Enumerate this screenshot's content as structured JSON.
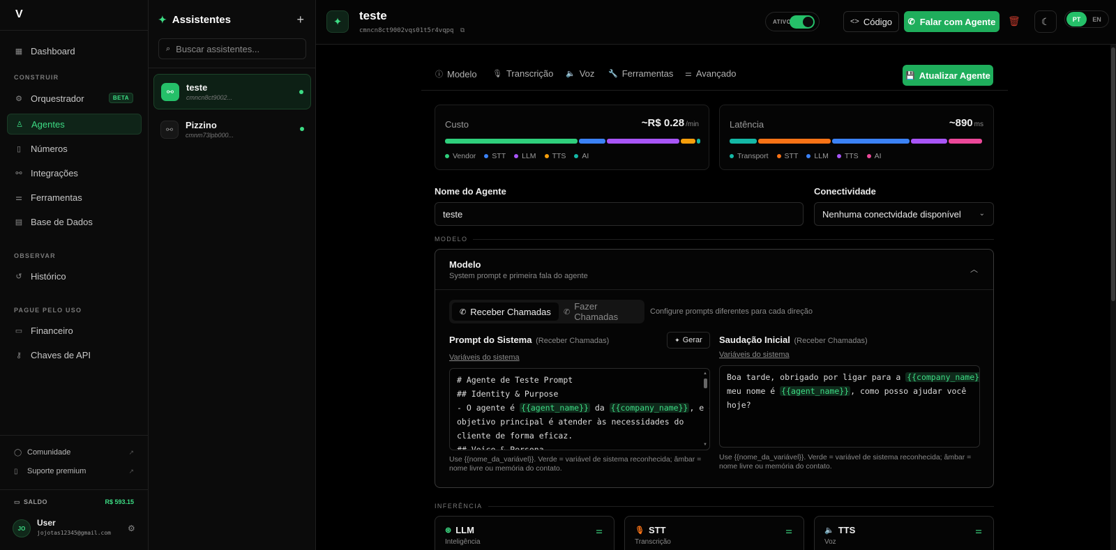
{
  "app": {
    "logo": "V"
  },
  "sidebar": {
    "dashboard": "Dashboard",
    "sections": {
      "construir": "CONSTRUIR",
      "observar": "OBSERVAR",
      "pague": "PAGUE PELO USO"
    },
    "items": {
      "orquestrador": "Orquestrador",
      "orquestrador_badge": "BETA",
      "agentes": "Agentes",
      "numeros": "Números",
      "integracoes": "Integrações",
      "ferramentas": "Ferramentas",
      "base_dados": "Base de Dados",
      "historico": "Histórico",
      "financeiro": "Financeiro",
      "chaves_api": "Chaves de API"
    },
    "footer": {
      "comunidade": "Comunidade",
      "suporte": "Suporte premium",
      "saldo_label": "SALDO",
      "saldo_value": "R$ 593.15"
    },
    "user": {
      "initials": "JO",
      "name": "User",
      "email": "jojotas12345@gmail.com"
    }
  },
  "assistants": {
    "title": "Assistentes",
    "add": "+",
    "search_placeholder": "Buscar assistentes...",
    "list": [
      {
        "name": "teste",
        "id": "cmncn8ct9002..."
      },
      {
        "name": "Pizzino",
        "id": "cmnm73lpb000..."
      }
    ]
  },
  "topbar": {
    "agent_name": "teste",
    "agent_id": "cmncn8ct9002vqs01t5r4vqpq",
    "status_label": "ATIVO",
    "status_on": true,
    "code_button": "Código",
    "talk_button": "Falar com Agente",
    "lang_active": "PT",
    "lang_other": "EN"
  },
  "tabs": [
    "Modelo",
    "Transcrição",
    "Voz",
    "Ferramentas",
    "Avançado"
  ],
  "update_button": "Atualizar Agente",
  "metrics": {
    "cost": {
      "label": "Custo",
      "value": "~R$ 0.28",
      "unit": "/min",
      "legend": [
        "Vendor",
        "STT",
        "LLM",
        "TTS",
        "AI"
      ],
      "colors": [
        "#2fcf7c",
        "#3b82f6",
        "#a855f7",
        "#f59e0b",
        "#14b8a6"
      ],
      "shares": [
        0.53,
        0.105,
        0.29,
        0.06,
        0.015
      ]
    },
    "latency": {
      "label": "Latência",
      "value": "~890",
      "unit": "ms",
      "legend": [
        "Transport",
        "STT",
        "LLM",
        "TTS",
        "AI"
      ],
      "colors": [
        "#14b8a6",
        "#f97316",
        "#3b82f6",
        "#a855f7",
        "#ec4899"
      ],
      "shares": [
        0.11,
        0.29,
        0.31,
        0.145,
        0.135
      ]
    }
  },
  "form": {
    "agent_name_label": "Nome do Agente",
    "agent_name_value": "teste",
    "connectivity_label": "Conectividade",
    "connectivity_value": "Nenhuma conectvidade disponível"
  },
  "model_section": {
    "section_label": "MODELO",
    "title": "Modelo",
    "subtitle": "System prompt e primeira fala do agente",
    "seg_receive": "Receber Chamadas",
    "seg_make": "Fazer Chamadas",
    "seg_hint": "Configure prompts diferentes para cada direção",
    "prompt_title": "Prompt do Sistema",
    "prompt_sub": "(Receber Chamadas)",
    "generate": "Gerar",
    "vars_link": "Variáveis do sistema",
    "prompt_lines": {
      "l1": "# Agente de Teste Prompt",
      "l2": "## Identity & Purpose",
      "l3a": "- O agente é ",
      "l3v1": "{{agent_name}}",
      "l3b": " da ",
      "l3v2": "{{company_name}}",
      "l3c": ", e o",
      "l4": "objetivo principal é atender às necessidades do",
      "l5": "cliente de forma eficaz.",
      "l6": "## Voice & Persona"
    },
    "greeting_title": "Saudação Inicial",
    "greeting_sub": "(Receber Chamadas)",
    "greeting_lines": {
      "l1a": "Boa tarde, obrigado por ligar para a ",
      "l1v": "{{company_name}}",
      "l1b": ",",
      "l2a": "meu nome é ",
      "l2v": "{{agent_name}}",
      "l2b": ", como posso ajudar você",
      "l3": "hoje?"
    },
    "hint_l1": "Use {{nome_da_variável}}. Verde = variável de sistema reconhecida; âmbar =",
    "hint_l2": "nome livre ou memória do contato."
  },
  "inference": {
    "section_label": "INFERÊNCIA",
    "cards": [
      {
        "title": "LLM",
        "sub": "Inteligência"
      },
      {
        "title": "STT",
        "sub": "Transcrição"
      },
      {
        "title": "TTS",
        "sub": "Voz"
      }
    ]
  }
}
